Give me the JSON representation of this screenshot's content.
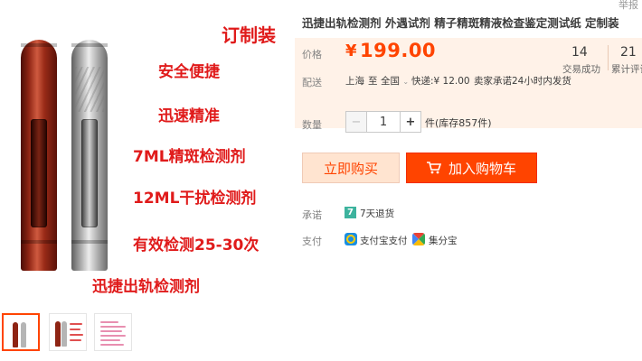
{
  "main_image": {
    "promo_lines": [
      "订制装",
      "安全便捷",
      "迅速精准",
      "7ML精斑检测剂",
      "12ML干扰检测剂",
      "有效检测25-30次",
      "迅捷出轨检测剂"
    ]
  },
  "thumbnails": [
    {
      "name": "vials-photo",
      "selected": true
    },
    {
      "name": "vials-with-text",
      "selected": false
    },
    {
      "name": "pink-text-card",
      "selected": false
    }
  ],
  "product": {
    "title": "迅捷出轨检测剂 外遇试剂 精子精斑精液检查鉴定测试纸 定制装",
    "corner_tag": "举报"
  },
  "price": {
    "label": "价格",
    "currency": "¥",
    "value": "199.00"
  },
  "stats": {
    "sales_count": "14",
    "sales_label": "交易成功",
    "reviews_count": "21",
    "reviews_label": "累计评论"
  },
  "shipping": {
    "label": "配送",
    "from": "上海",
    "to_prefix": "至",
    "to": "全国",
    "caret": "⌄",
    "express": "快递:¥ 12.00",
    "promise": "卖家承诺24小时内发货"
  },
  "quantity": {
    "label": "数量",
    "minus": "−",
    "value": "1",
    "plus": "+",
    "stock": "件(库存857件)"
  },
  "buttons": {
    "buy_now": "立即购买",
    "add_to_cart": "加入购物车"
  },
  "guarantee": {
    "label": "承诺",
    "icon_char": "7",
    "text": "7天退货"
  },
  "payment": {
    "label": "支付",
    "methods": [
      "支付宝支付",
      "集分宝"
    ]
  },
  "colors": {
    "accent": "#ff4400",
    "price_bg": "#fff2e8",
    "promo_red": "#e01b1b",
    "promise_green": "#3db39e"
  }
}
